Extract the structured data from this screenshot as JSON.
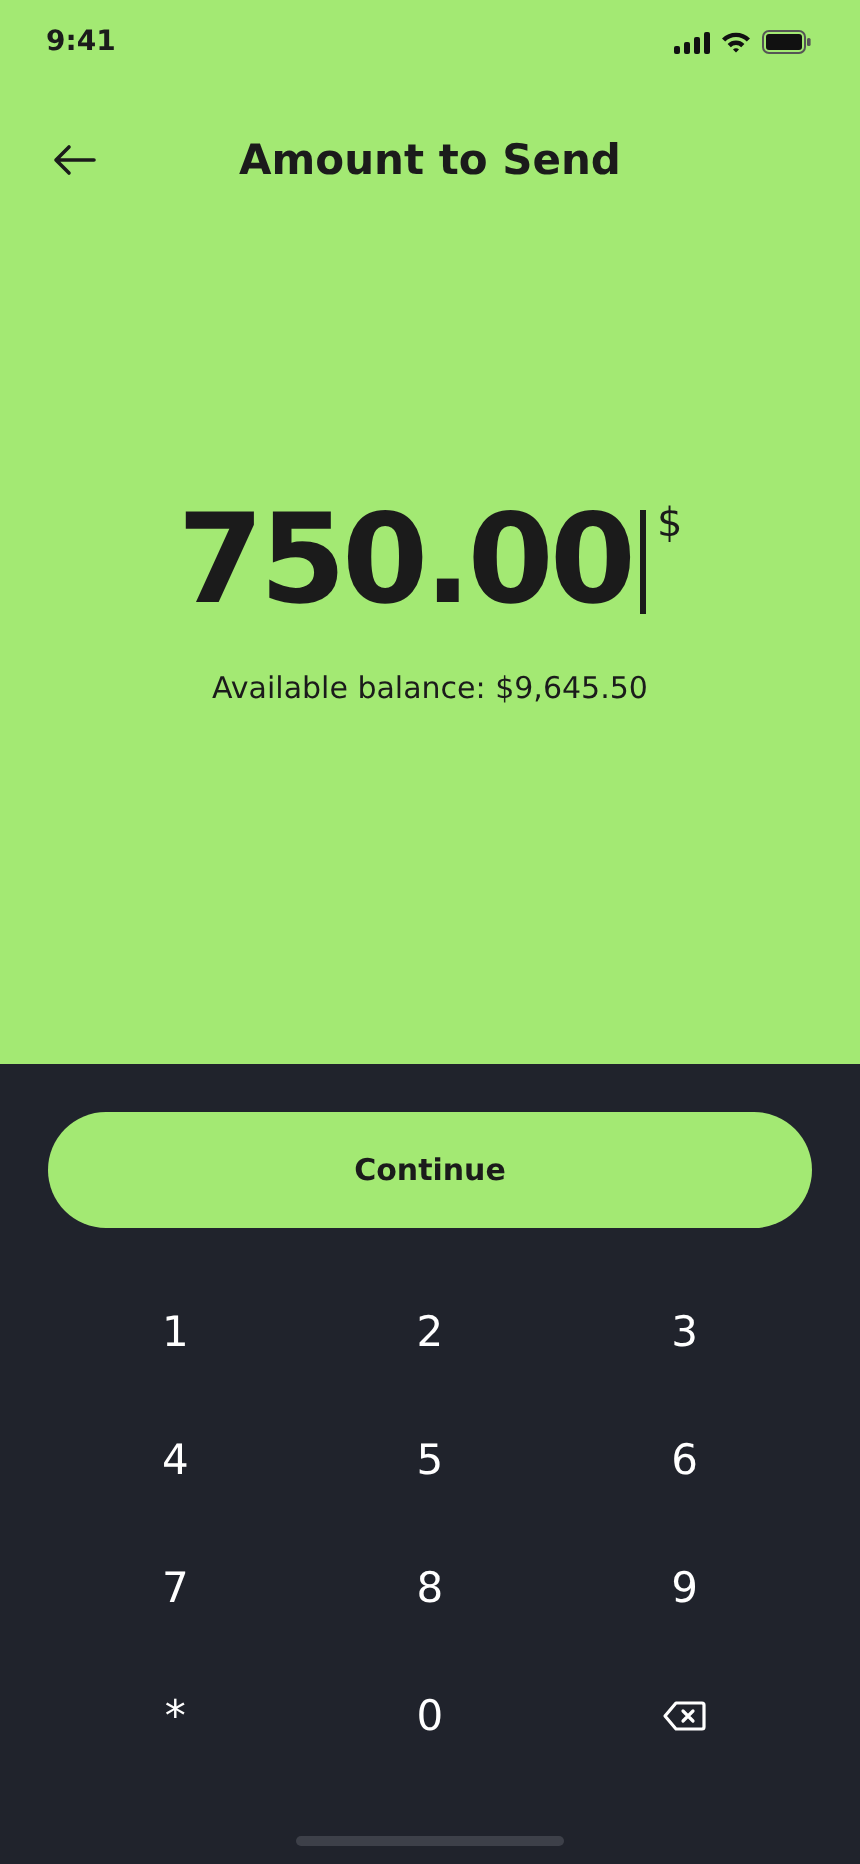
{
  "status_bar": {
    "time": "9:41"
  },
  "header": {
    "title": "Amount to Send"
  },
  "amount": {
    "value": "750.00",
    "currency": "$"
  },
  "balance": "Available balance: $9,645.50",
  "continue_button": "Continue",
  "keypad": [
    {
      "kind": "digit",
      "label": "1"
    },
    {
      "kind": "digit",
      "label": "2"
    },
    {
      "kind": "digit",
      "label": "3"
    },
    {
      "kind": "digit",
      "label": "4"
    },
    {
      "kind": "digit",
      "label": "5"
    },
    {
      "kind": "digit",
      "label": "6"
    },
    {
      "kind": "digit",
      "label": "7"
    },
    {
      "kind": "digit",
      "label": "8"
    },
    {
      "kind": "digit",
      "label": "9"
    },
    {
      "kind": "digit",
      "label": "*"
    },
    {
      "kind": "digit",
      "label": "0"
    },
    {
      "kind": "backspace"
    }
  ]
}
